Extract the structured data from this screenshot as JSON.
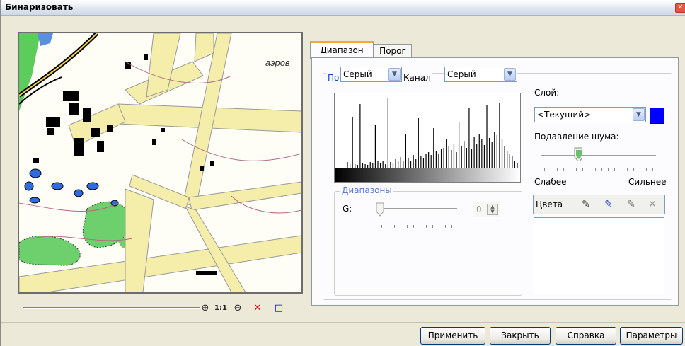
{
  "window": {
    "title": "Бинаризовать",
    "close_glyph": "✕"
  },
  "map": {
    "label": "аэров"
  },
  "zoombar": {
    "zoom_in": "⊕",
    "one_to_one": "1:1",
    "zoom_out": "⊖",
    "clear": "✕",
    "frame": "□"
  },
  "tabs": [
    {
      "label": "Диапазон",
      "active": true
    },
    {
      "label": "Порог",
      "active": false
    }
  ],
  "by_group": {
    "legend": "По",
    "by_value": "Серый",
    "channel_label": "Канал",
    "channel_value": "Серый"
  },
  "layer": {
    "label": "Слой:",
    "value": "<Текущий>",
    "color": "#0000ff"
  },
  "noise": {
    "label": "Подавление шума:",
    "min_label": "Слабее",
    "max_label": "Сильнее",
    "level": 0.33
  },
  "ranges": {
    "legend": "Диапазоны",
    "g_label": "G:",
    "g_value": "0"
  },
  "colors_panel": {
    "label": "Цвета",
    "icons": [
      "eyedropper-icon",
      "eyedropper-add-icon",
      "eyedropper-remove-icon",
      "delete-icon"
    ]
  },
  "buttons": {
    "apply": "Применить",
    "close": "Закрыть",
    "help": "Справка",
    "params": "Параметры"
  },
  "histogram": {
    "bars": [
      8,
      5,
      72,
      5,
      4,
      90,
      6,
      5,
      4,
      8,
      7,
      60,
      9,
      6,
      10,
      5,
      98,
      8,
      6,
      12,
      10,
      15,
      9,
      48,
      14,
      10,
      18,
      12,
      70,
      16,
      14,
      20,
      22,
      18,
      56,
      24,
      20,
      26,
      28,
      40,
      30,
      25,
      34,
      22,
      65,
      30,
      38,
      28,
      85,
      26,
      44,
      34,
      48,
      40,
      32,
      88,
      42,
      36,
      50,
      46,
      92,
      40,
      30,
      24,
      20,
      16,
      10,
      6
    ]
  },
  "colors": {
    "accent_tab": "#f4a838",
    "blue_legend": "#0046d5"
  }
}
